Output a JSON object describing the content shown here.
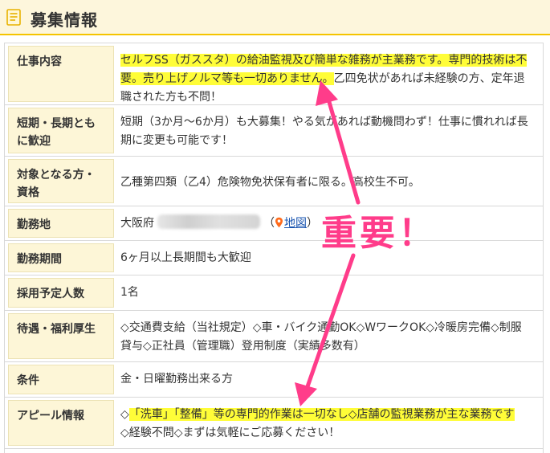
{
  "header": {
    "title": "募集情報",
    "icon": "document-icon"
  },
  "rows": [
    {
      "label": "仕事内容",
      "hl1": "セルフSS（ガススタ）の給油監視及び簡単な雑務が主業務です。専門的技術は不",
      "hl2": "要。売り上げノルマ等も一切ありません。",
      "rest1": "乙四免状があれば未経験の方、定年退",
      "rest2": "職された方も不問！"
    },
    {
      "label1": "短期・長期とも",
      "label2": "に歓迎",
      "text1": "短期（3か月〜6か月）も大募集！やる気があれば動機問わず！仕事に慣れれば長",
      "text2": "期に変更も可能です！"
    },
    {
      "label1": "対象となる方・",
      "label2": "資格",
      "text": "乙種第四類（乙4）危険物免状保有者に限る。高校生不可。"
    },
    {
      "label": "勤務地",
      "prefix": "大阪府",
      "paren_open": "（",
      "map_link": "地図",
      "paren_close": "）"
    },
    {
      "label": "勤務期間",
      "text": "6ヶ月以上長期間も大歓迎"
    },
    {
      "label": "採用予定人数",
      "text": "1名"
    },
    {
      "label": "待遇・福利厚生",
      "text1": "◇交通費支給（当社規定）◇車・バイク通勤OK◇WワークOK◇冷暖房完備◇制服",
      "text2": "貸与◇正社員（管理職）登用制度（実績多数有）"
    },
    {
      "label": "条件",
      "text": "金・日曜勤務出来る方"
    },
    {
      "label": "アピール情報",
      "lead": "◇",
      "hl": "「洗車」「整備」等の専門的作業は一切なし◇店舗の監視業務が主な業務です",
      "text2": "◇経験不問◇まずは気軽にご応募ください！"
    }
  ],
  "annotation": {
    "text": "重要！",
    "color": "#ff3c8a"
  },
  "colors": {
    "accent": "#f5c400",
    "label_bg": "#fdf6d7",
    "highlight": "#fffd38",
    "link": "#1a55b0"
  }
}
